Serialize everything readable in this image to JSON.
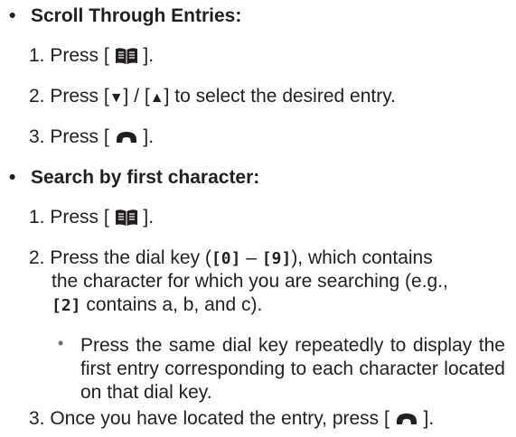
{
  "section1": {
    "bullet": "•",
    "title": "Scroll Through Entries:",
    "step1_prefix": "1. Press [",
    "step1_suffix": "].",
    "step2_prefix": "2. Press [",
    "step2_mid": "] / [",
    "step2_suffix": "] to select the desired entry.",
    "step3_prefix": "3. Press [",
    "step3_suffix": "].",
    "down_glyph": "▼",
    "up_glyph": "▲"
  },
  "section2": {
    "bullet": "•",
    "title": "Search by first character:",
    "step1_prefix": "1. Press [",
    "step1_suffix": "].",
    "step2_a": "2. Press the dial key (",
    "key0": "[0]",
    "dash": " – ",
    "key9": "[9]",
    "step2_b": "), which contains",
    "step2_c": "the character for which you are searching (e.g.,",
    "key2": "[2]",
    "step2_d": " contains a, b, and c).",
    "sub_dot": "•",
    "sub_text": "Press the same dial key repeatedly to display the first entry corresponding to each character located on that dial key.",
    "step3_prefix": "3. Once you have located the entry, press [",
    "step3_suffix": "]."
  },
  "icons": {
    "book": "phonebook-icon",
    "talk": "talk-handset-icon"
  }
}
